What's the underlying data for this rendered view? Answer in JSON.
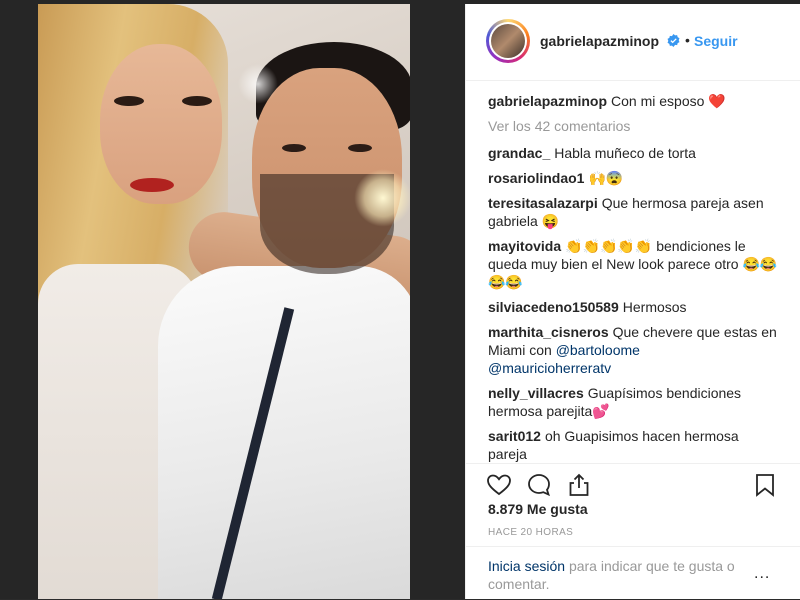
{
  "post": {
    "username": "gabrielapazminop",
    "verified_icon": "verified-badge-icon",
    "separator": "•",
    "follow_label": "Seguir",
    "caption_user": "gabrielapazminop",
    "caption_text": "Con mi esposo ❤️",
    "view_all_comments": "Ver los 42 comentarios"
  },
  "comments": [
    {
      "user": "grandac_",
      "text": "Habla muñeco de torta"
    },
    {
      "user": "rosariolindao1",
      "text": "🙌😨"
    },
    {
      "user": "teresitasalazarpi",
      "text": "Que hermosa pareja asen gabriela 😝"
    },
    {
      "user": "mayitovida",
      "text": "👏👏👏👏👏 bendiciones le queda muy bien el New look parece otro 😂😂😂😂"
    },
    {
      "user": "silviacedeno150589",
      "text": "Hermosos"
    },
    {
      "user": "marthita_cisneros",
      "text": "Que chevere que estas en Miami con",
      "mention1": "@bartoloome",
      "mention2": "@mauricioherreratv"
    },
    {
      "user": "nelly_villacres",
      "text": "Guapísimos bendiciones hermosa parejita💕"
    },
    {
      "user": "sarit012",
      "text": "oh Guapisimos hacen hermosa pareja"
    }
  ],
  "actions": {
    "like_icon": "heart-icon",
    "comment_icon": "comment-icon",
    "share_icon": "share-icon",
    "save_icon": "bookmark-icon"
  },
  "likes": "8.879 Me gusta",
  "time_ago": "HACE 20 HORAS",
  "login": {
    "link": "Inicia sesión",
    "text": "para indicar que te gusta o comentar.",
    "more": "..."
  }
}
